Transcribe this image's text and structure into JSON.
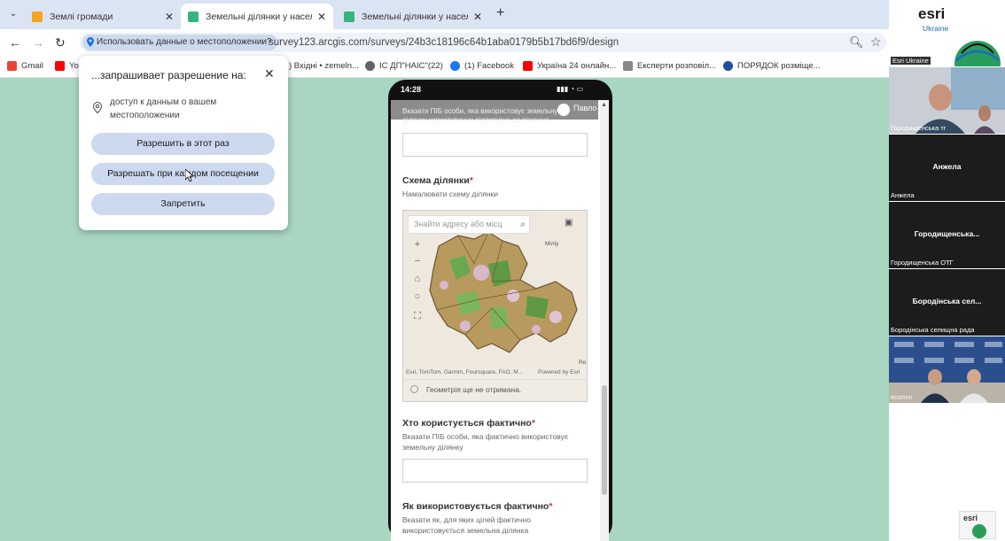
{
  "browser": {
    "tabs": [
      {
        "title": "Землі громади",
        "favicon_color": "#f4a623"
      },
      {
        "title": "Земельні ділянки у населени",
        "favicon_color": "#36b37e"
      },
      {
        "title": "Земельні ділянки у населени",
        "favicon_color": "#36b37e"
      }
    ],
    "tab_menu_icon": "chevron-down-icon",
    "new_tab_label": "+",
    "permission_chip": "Использовать данные о местоположении?",
    "url": "survey123.arcgis.com/surveys/24b3c18196c64b1aba0179b5b17bd6f9/design",
    "bookmarks": [
      {
        "label": "Gmail",
        "color": "#ea4335"
      },
      {
        "label": "Yo",
        "color": "#ff0000"
      },
      {
        "label": ") Вхідні • zemeln...",
        "color": ""
      },
      {
        "label": "ІС ДП\"НАІС\"(22)",
        "color": "#5f6368"
      },
      {
        "label": "(1) Facebook",
        "color": "#1877f2"
      },
      {
        "label": "Україна 24 онлайн...",
        "color": "#ff0000"
      },
      {
        "label": "Експерти розповіл...",
        "color": "#888888"
      },
      {
        "label": "ПОРЯДОК розміще...",
        "color": "#1f4e9e"
      }
    ]
  },
  "popup": {
    "title": "...запрашивает разрешение на:",
    "description": "доступ к данным о вашем местоположении",
    "allow_once": "Разрешить в этот раз",
    "allow_always": "Разрешать при каждом посещении",
    "deny": "Запретить"
  },
  "phone": {
    "time": "14:28",
    "signal": "▮▮▮ ◔ ▭",
    "profile_name": "Павло",
    "top_hint": "Вказати ПІБ особи, яка використовує земельну ділянку користування відповідно до рішення",
    "field_scheme_label": "Схема ділянки",
    "field_scheme_hint": "Намалювати схему ділянки",
    "map_search_placeholder": "Знайти адресу або місц",
    "map_place_label": "Міліу",
    "map_corner_label": "Ro",
    "map_attribution": "Esri, TomTom, Garmin, Foursquare, FAO, M...",
    "map_powered": "Powered by Esri",
    "geometry_status": "Геометрія ще не отримана.",
    "field_user_label": "Хто користується фактично",
    "field_user_hint": "Вказати ПІБ особи, яка фактично використовує земельну ділянку",
    "field_usage_label": "Як використовується фактично",
    "field_usage_hint": "Вказати як, для яких цілей фактично використовується земельна ділянка",
    "required_mark": "*"
  },
  "video": {
    "logo_text": "esri",
    "logo_sub": "Ukraine",
    "tiles": [
      {
        "name": "Esri Ukraine",
        "center": ""
      },
      {
        "name": "Городищенська тг",
        "center": ""
      },
      {
        "name": "Анжела",
        "center": "Анжела"
      },
      {
        "name": "Городищенська ОТГ",
        "center": "Городищенська..."
      },
      {
        "name": "Бородінська селищна рада",
        "center": "Бородінська сел..."
      },
      {
        "name": "ecomm",
        "center": ""
      }
    ],
    "bottom_logo": "esri"
  },
  "colors": {
    "desktop_bg": "#a8d6c1",
    "chip_bg": "#cdd9ee",
    "required": "#c0392b"
  }
}
